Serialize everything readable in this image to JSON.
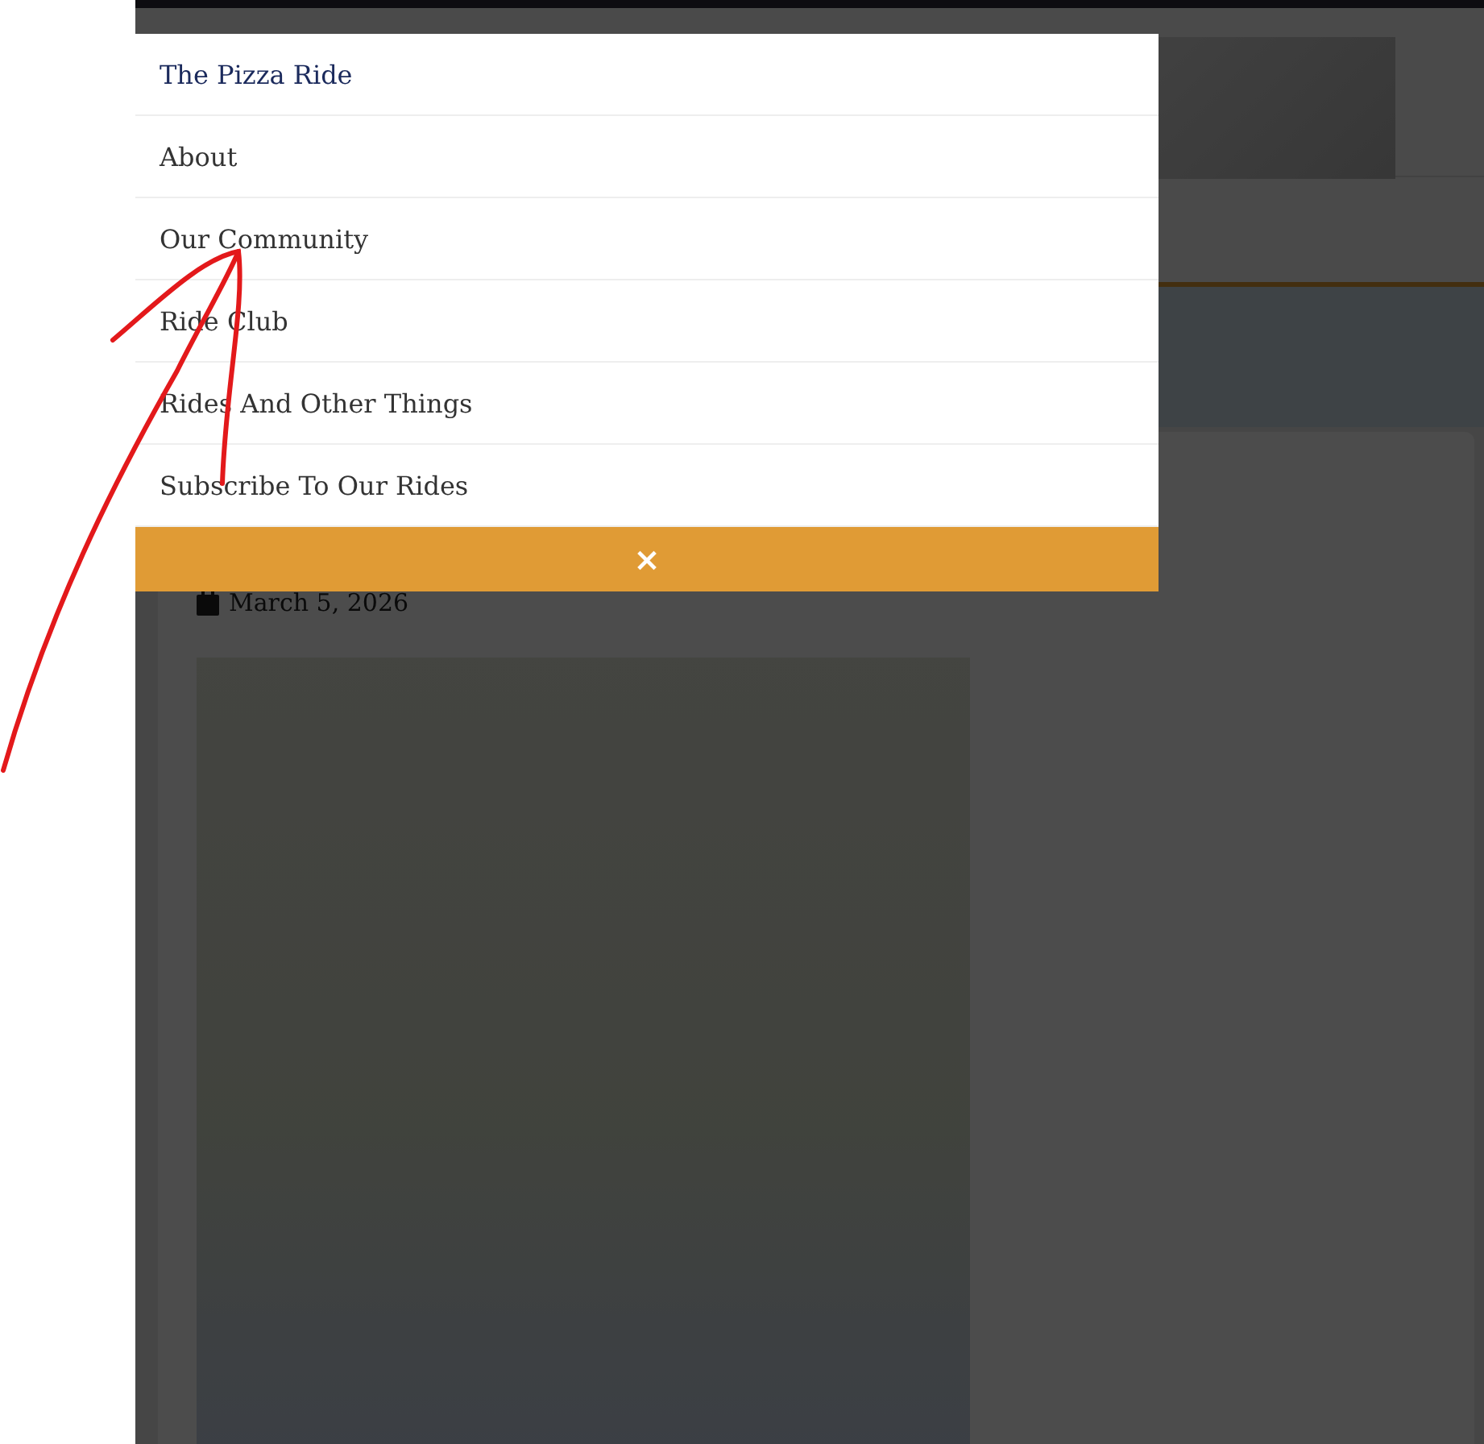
{
  "menu": {
    "items": [
      {
        "label": "The Pizza Ride",
        "selected": true
      },
      {
        "label": "About",
        "selected": false
      },
      {
        "label": "Our Community",
        "selected": false
      },
      {
        "label": "Ride Club",
        "selected": false
      },
      {
        "label": "Rides And Other Things",
        "selected": false
      },
      {
        "label": "Subscribe To Our Rides",
        "selected": false
      }
    ],
    "close": "×"
  },
  "post": {
    "date": "March 5, 2026"
  }
}
